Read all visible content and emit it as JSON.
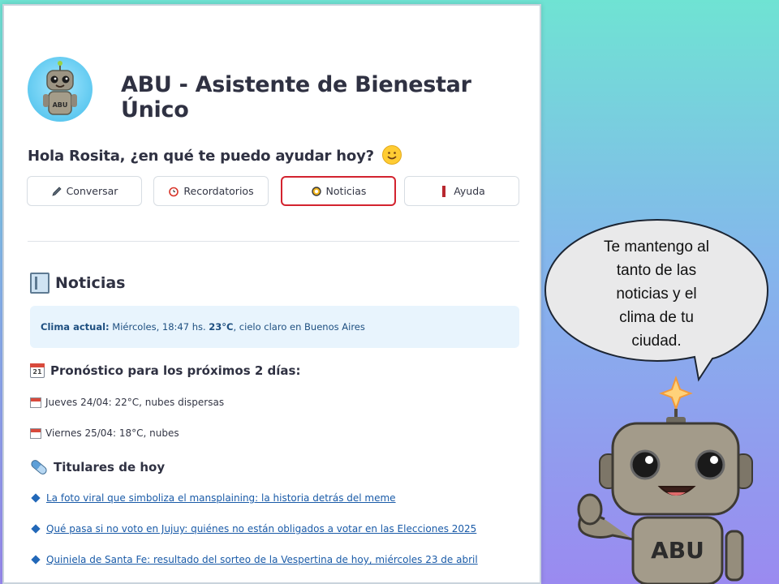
{
  "app": {
    "title": "ABU - Asistente de Bienestar Único",
    "avatar_label": "ABU"
  },
  "greeting": "Hola Rosita, ¿en qué te puedo ayudar hoy?",
  "tabs": [
    {
      "label": "Conversar",
      "icon": "pencil-icon",
      "active": false
    },
    {
      "label": "Recordatorios",
      "icon": "alarm-clock-icon",
      "active": false
    },
    {
      "label": "Noticias",
      "icon": "sun-icon",
      "active": true
    },
    {
      "label": "Ayuda",
      "icon": "bar-icon",
      "active": false
    }
  ],
  "news": {
    "section_title": "Noticias",
    "climate": {
      "label": "Clima actual:",
      "prefix": "Miércoles, 18:47 hs.",
      "temp": "23°C",
      "suffix": ", cielo claro en Buenos Aires"
    },
    "forecast_title": "Pronóstico para los próximos 2 días:",
    "calendar_day": "21",
    "forecast": [
      "Jueves 24/04: 22°C, nubes dispersas",
      "Viernes 25/04: 18°C, nubes"
    ],
    "headlines_title": "Titulares de hoy",
    "headlines": [
      "La foto viral que simboliza el mansplaining: la historia detrás del meme",
      "Qué pasa si no voto en Jujuy: quiénes no están obligados a votar en las Elecciones 2025",
      "Quiniela de Santa Fe: resultado del sorteo de la Vespertina de hoy, miércoles 23 de abril"
    ]
  },
  "speech_bubble": {
    "lines": [
      "Te mantengo al",
      "tanto de las",
      "noticias y el",
      "clima de tu",
      "ciudad."
    ]
  },
  "robot": {
    "chest_label": "ABU"
  },
  "colors": {
    "active_tab_border": "#d3232f",
    "link": "#1a5ba8",
    "climate_bg": "#e8f4fd",
    "climate_text": "#1e4f80"
  }
}
